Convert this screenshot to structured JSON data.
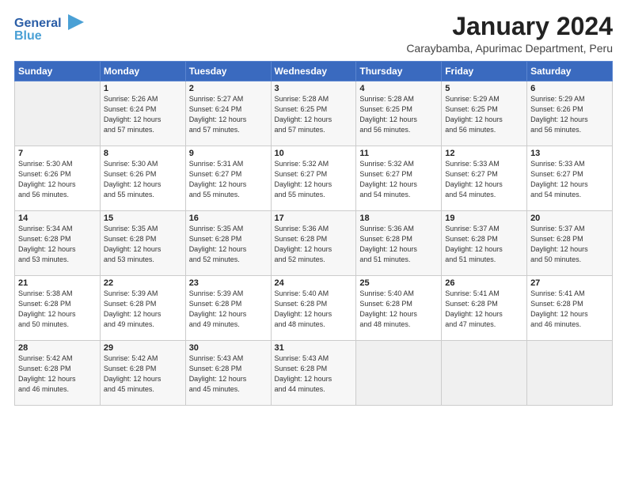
{
  "logo": {
    "line1": "General",
    "line2": "Blue"
  },
  "title": "January 2024",
  "subtitle": "Caraybamba, Apurimac Department, Peru",
  "header_days": [
    "Sunday",
    "Monday",
    "Tuesday",
    "Wednesday",
    "Thursday",
    "Friday",
    "Saturday"
  ],
  "weeks": [
    [
      {
        "day": "",
        "info": ""
      },
      {
        "day": "1",
        "info": "Sunrise: 5:26 AM\nSunset: 6:24 PM\nDaylight: 12 hours\nand 57 minutes."
      },
      {
        "day": "2",
        "info": "Sunrise: 5:27 AM\nSunset: 6:24 PM\nDaylight: 12 hours\nand 57 minutes."
      },
      {
        "day": "3",
        "info": "Sunrise: 5:28 AM\nSunset: 6:25 PM\nDaylight: 12 hours\nand 57 minutes."
      },
      {
        "day": "4",
        "info": "Sunrise: 5:28 AM\nSunset: 6:25 PM\nDaylight: 12 hours\nand 56 minutes."
      },
      {
        "day": "5",
        "info": "Sunrise: 5:29 AM\nSunset: 6:25 PM\nDaylight: 12 hours\nand 56 minutes."
      },
      {
        "day": "6",
        "info": "Sunrise: 5:29 AM\nSunset: 6:26 PM\nDaylight: 12 hours\nand 56 minutes."
      }
    ],
    [
      {
        "day": "7",
        "info": "Sunrise: 5:30 AM\nSunset: 6:26 PM\nDaylight: 12 hours\nand 56 minutes."
      },
      {
        "day": "8",
        "info": "Sunrise: 5:30 AM\nSunset: 6:26 PM\nDaylight: 12 hours\nand 55 minutes."
      },
      {
        "day": "9",
        "info": "Sunrise: 5:31 AM\nSunset: 6:27 PM\nDaylight: 12 hours\nand 55 minutes."
      },
      {
        "day": "10",
        "info": "Sunrise: 5:32 AM\nSunset: 6:27 PM\nDaylight: 12 hours\nand 55 minutes."
      },
      {
        "day": "11",
        "info": "Sunrise: 5:32 AM\nSunset: 6:27 PM\nDaylight: 12 hours\nand 54 minutes."
      },
      {
        "day": "12",
        "info": "Sunrise: 5:33 AM\nSunset: 6:27 PM\nDaylight: 12 hours\nand 54 minutes."
      },
      {
        "day": "13",
        "info": "Sunrise: 5:33 AM\nSunset: 6:27 PM\nDaylight: 12 hours\nand 54 minutes."
      }
    ],
    [
      {
        "day": "14",
        "info": "Sunrise: 5:34 AM\nSunset: 6:28 PM\nDaylight: 12 hours\nand 53 minutes."
      },
      {
        "day": "15",
        "info": "Sunrise: 5:35 AM\nSunset: 6:28 PM\nDaylight: 12 hours\nand 53 minutes."
      },
      {
        "day": "16",
        "info": "Sunrise: 5:35 AM\nSunset: 6:28 PM\nDaylight: 12 hours\nand 52 minutes."
      },
      {
        "day": "17",
        "info": "Sunrise: 5:36 AM\nSunset: 6:28 PM\nDaylight: 12 hours\nand 52 minutes."
      },
      {
        "day": "18",
        "info": "Sunrise: 5:36 AM\nSunset: 6:28 PM\nDaylight: 12 hours\nand 51 minutes."
      },
      {
        "day": "19",
        "info": "Sunrise: 5:37 AM\nSunset: 6:28 PM\nDaylight: 12 hours\nand 51 minutes."
      },
      {
        "day": "20",
        "info": "Sunrise: 5:37 AM\nSunset: 6:28 PM\nDaylight: 12 hours\nand 50 minutes."
      }
    ],
    [
      {
        "day": "21",
        "info": "Sunrise: 5:38 AM\nSunset: 6:28 PM\nDaylight: 12 hours\nand 50 minutes."
      },
      {
        "day": "22",
        "info": "Sunrise: 5:39 AM\nSunset: 6:28 PM\nDaylight: 12 hours\nand 49 minutes."
      },
      {
        "day": "23",
        "info": "Sunrise: 5:39 AM\nSunset: 6:28 PM\nDaylight: 12 hours\nand 49 minutes."
      },
      {
        "day": "24",
        "info": "Sunrise: 5:40 AM\nSunset: 6:28 PM\nDaylight: 12 hours\nand 48 minutes."
      },
      {
        "day": "25",
        "info": "Sunrise: 5:40 AM\nSunset: 6:28 PM\nDaylight: 12 hours\nand 48 minutes."
      },
      {
        "day": "26",
        "info": "Sunrise: 5:41 AM\nSunset: 6:28 PM\nDaylight: 12 hours\nand 47 minutes."
      },
      {
        "day": "27",
        "info": "Sunrise: 5:41 AM\nSunset: 6:28 PM\nDaylight: 12 hours\nand 46 minutes."
      }
    ],
    [
      {
        "day": "28",
        "info": "Sunrise: 5:42 AM\nSunset: 6:28 PM\nDaylight: 12 hours\nand 46 minutes."
      },
      {
        "day": "29",
        "info": "Sunrise: 5:42 AM\nSunset: 6:28 PM\nDaylight: 12 hours\nand 45 minutes."
      },
      {
        "day": "30",
        "info": "Sunrise: 5:43 AM\nSunset: 6:28 PM\nDaylight: 12 hours\nand 45 minutes."
      },
      {
        "day": "31",
        "info": "Sunrise: 5:43 AM\nSunset: 6:28 PM\nDaylight: 12 hours\nand 44 minutes."
      },
      {
        "day": "",
        "info": ""
      },
      {
        "day": "",
        "info": ""
      },
      {
        "day": "",
        "info": ""
      }
    ]
  ]
}
